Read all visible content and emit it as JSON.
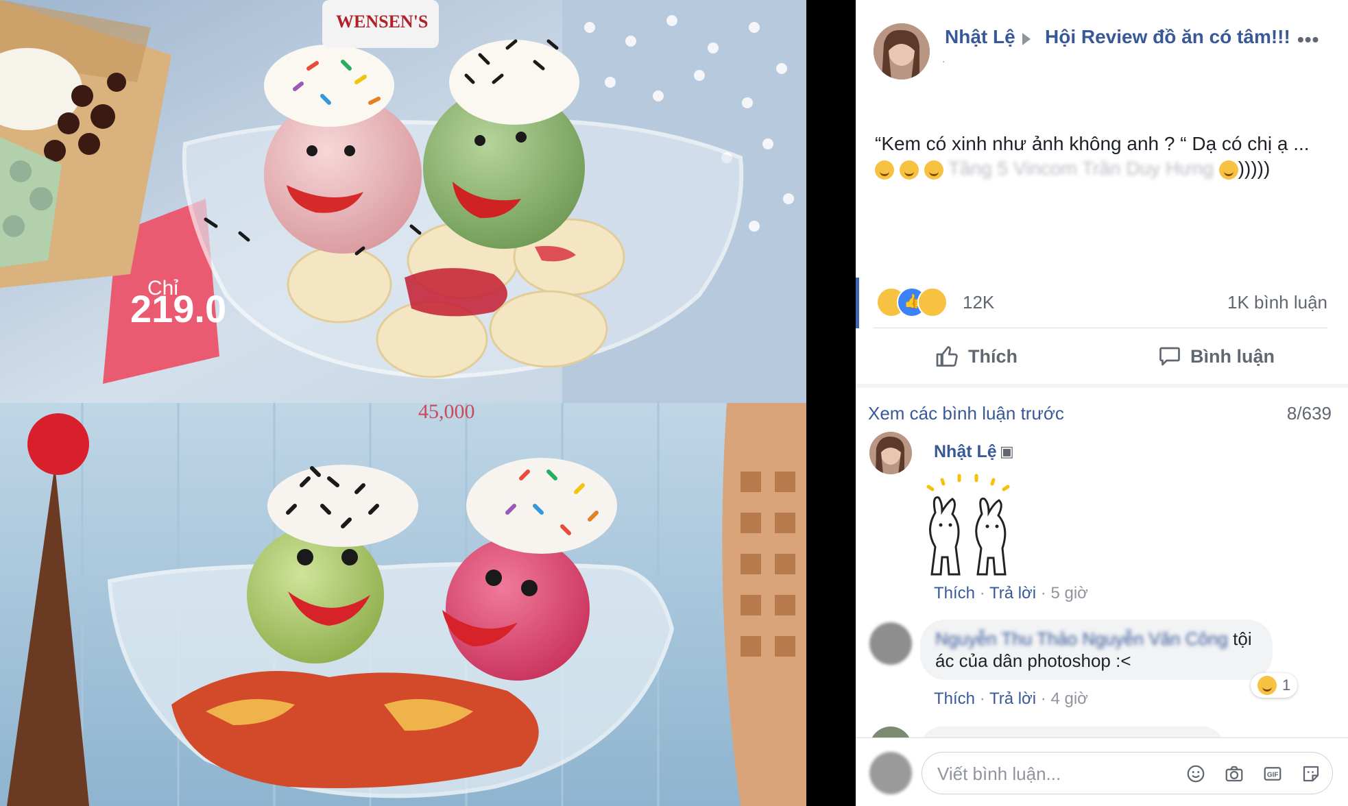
{
  "post": {
    "author": "Nhật Lệ",
    "group": "Hội Review đồ ăn có tâm!!!",
    "separator": ".",
    "text_line1": "“Kem có xinh như ảnh không anh ? “ Dạ có chị ạ ...",
    "text_line2_blurred": "Tầng 5 Vincom Trần Duy Hưng",
    "text_line2_tail": ")))))",
    "more": "•••"
  },
  "photos": {
    "price_tag": "45,000",
    "chi_text": "Chỉ",
    "price_text": "219.0"
  },
  "stats": {
    "reactions_count": "12K",
    "comments_count": "1K bình luận"
  },
  "actions": {
    "like": "Thích",
    "comment": "Bình luận"
  },
  "comments": {
    "view_previous": "Xem các bình luận trước",
    "page": "8/639",
    "items": [
      {
        "name": "Nhật Lệ",
        "like": "Thích",
        "reply": "Trả lời",
        "time": "5 giờ"
      },
      {
        "name_blurred": "Nguyễn Thu Thảo Nguyễn Văn Công",
        "text_tail": "tội",
        "text_line2": "ác của dân photoshop :<",
        "like": "Thích",
        "reply": "Trả lời",
        "time": "4 giờ",
        "reaction_count": "1"
      }
    ]
  },
  "composer": {
    "placeholder": "Viết bình luận..."
  },
  "colors": {
    "fb_blue": "#385898",
    "accent": "#4267b2"
  }
}
